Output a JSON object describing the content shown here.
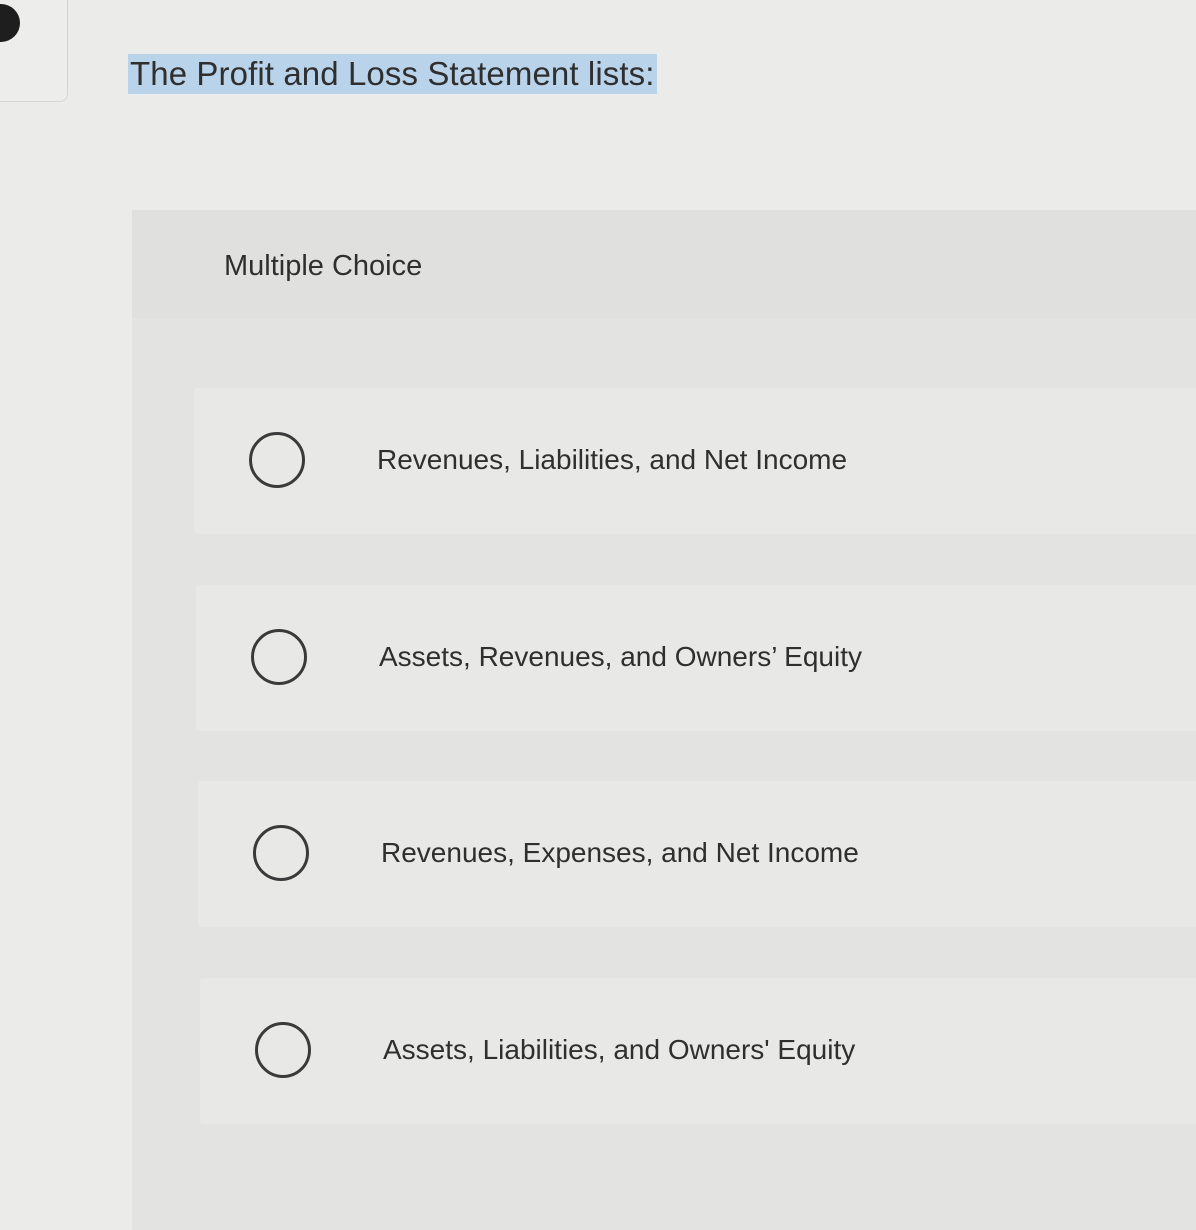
{
  "question": {
    "text": "The Profit and Loss Statement lists:"
  },
  "panel": {
    "title": "Multiple Choice"
  },
  "options": [
    {
      "label": "Revenues, Liabilities, and Net Income"
    },
    {
      "label": "Assets, Revenues, and Owners’ Equity"
    },
    {
      "label": "Revenues, Expenses, and Net Income"
    },
    {
      "label": "Assets, Liabilities, and Owners' Equity"
    }
  ],
  "colors": {
    "highlight": "#b9d3ea",
    "background": "#ebebea",
    "text": "#2f2f2f"
  }
}
